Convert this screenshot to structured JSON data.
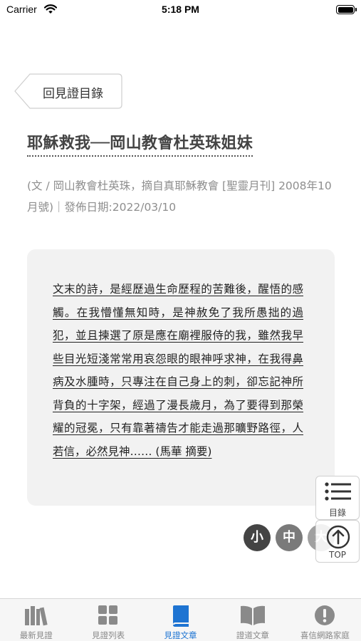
{
  "status_bar": {
    "carrier": "Carrier",
    "time": "5:18 PM"
  },
  "back_button": {
    "label": "回見證目錄"
  },
  "article": {
    "title": "耶穌救我──岡山教會杜英珠姐妹",
    "meta": "(文 / 岡山教會杜英珠，摘自真耶穌教會 [聖靈月刊] 2008年10月號)｜發佈日期:2022/03/10",
    "summary": "文末的詩，是經歷過生命歷程的苦難後，醒悟的感觸。在我懵懂無知時，是神赦免了我所愚拙的過犯，並且揀選了原是應在廟裡服侍的我，雖然我早些目光短淺常常用哀怨眼的眼神呼求神，在我得鼻病及水腫時，只專注在自己身上的刺，卻忘記神所背負的十字架，經過了漫長歲月，為了要得到那榮耀的冠冕，只有靠著禱告才能走過那曠野路徑，人若信，必然見神…… (馬華 摘要)"
  },
  "font_size": {
    "small": "小",
    "medium": "中",
    "large": "大"
  },
  "floating": {
    "toc_label": "目錄",
    "top_label": "TOP"
  },
  "tab_bar": {
    "active_tab": "見證文章",
    "accent_color": "#1e74d2",
    "items": [
      {
        "label": "最新見證",
        "icon": "books-icon"
      },
      {
        "label": "見證列表",
        "icon": "grid-icon"
      },
      {
        "label": "見證文章",
        "icon": "book-icon"
      },
      {
        "label": "證道文章",
        "icon": "open-book-icon"
      },
      {
        "label": "喜信網路家庭",
        "icon": "exclamation-circle-icon"
      }
    ]
  }
}
